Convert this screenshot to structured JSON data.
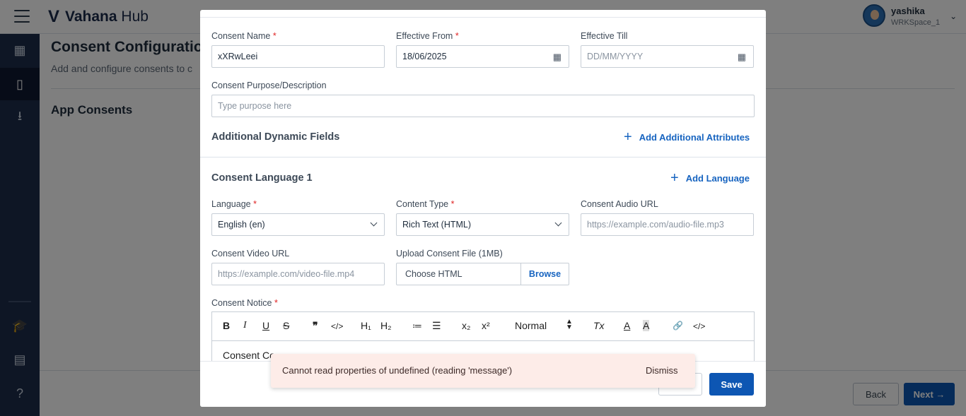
{
  "header": {
    "app_name_bold": "Vahana",
    "app_name_rest": " Hub",
    "user_name": "yashika",
    "workspace": "WRKSpace_1"
  },
  "sidebar": {
    "items": [
      {
        "icon": "dashboard-icon"
      },
      {
        "icon": "mobile-icon",
        "active": true
      },
      {
        "icon": "download-icon"
      },
      {
        "icon": "school-icon"
      },
      {
        "icon": "feedback-icon"
      },
      {
        "icon": "help-icon"
      }
    ]
  },
  "page": {
    "title": "Consent Configuration",
    "subtitle": "Add and configure consents to c",
    "section": "App Consents",
    "back_label": "Back",
    "next_label": "Next →"
  },
  "modal": {
    "consent_name_label": "Consent Name",
    "consent_name_value": "xXRwLeei",
    "effective_from_label": "Effective From",
    "effective_from_value": "18/06/2025",
    "effective_till_label": "Effective Till",
    "effective_till_placeholder": "DD/MM/YYYY",
    "purpose_label": "Consent Purpose/Description",
    "purpose_placeholder": "Type purpose here",
    "dynamic_fields_title": "Additional Dynamic Fields",
    "add_attributes_label": "Add Additional Attributes",
    "language_section_title": "Consent Language 1",
    "add_language_label": "Add Language",
    "language_label": "Language",
    "language_value": "English (en)",
    "content_type_label": "Content Type",
    "content_type_value": "Rich Text (HTML)",
    "audio_url_label": "Consent Audio URL",
    "audio_url_placeholder": "https://example.com/audio-file.mp3",
    "video_url_label": "Consent Video URL",
    "video_url_placeholder": "https://example.com/video-file.mp4",
    "upload_label": "Upload Consent File (1MB)",
    "upload_placeholder": "Choose HTML",
    "browse_label": "Browse",
    "notice_label": "Consent Notice",
    "required_mark": "*",
    "toolbar": {
      "bold": "B",
      "italic": "I",
      "underline": "U",
      "strike": "S",
      "quote": "❞",
      "code": "</>",
      "h1": "H₁",
      "h2": "H₂",
      "ordered_list": "≔",
      "bullet_list": "☰",
      "subscript": "x₂",
      "superscript": "x²",
      "size_value": "Normal",
      "clear_format": "Tx",
      "text_color": "A",
      "highlight": "A",
      "link": "🔗",
      "code_view": "</>"
    },
    "notice_text": "Consent  Co",
    "save_label": "Save"
  },
  "toast": {
    "message": "Cannot read properties of undefined (reading 'message')",
    "dismiss_label": "Dismiss"
  }
}
